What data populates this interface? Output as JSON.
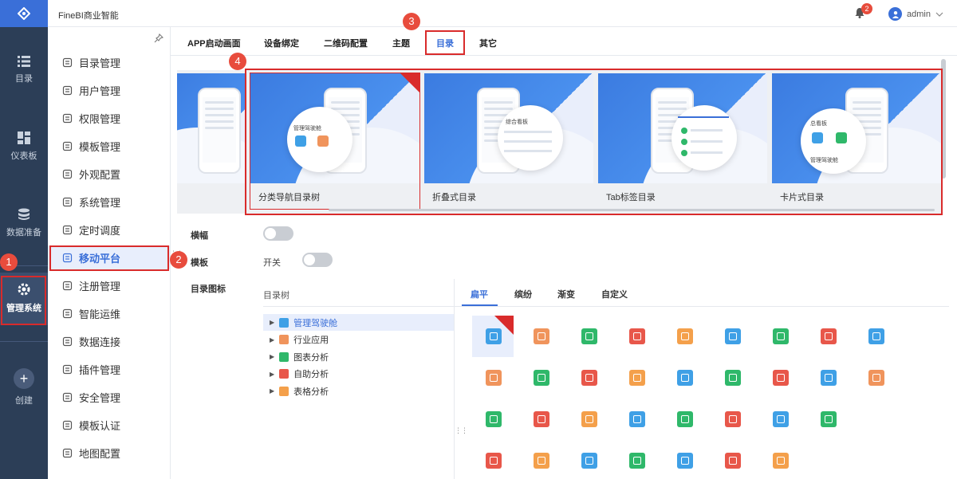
{
  "app": {
    "brand": "FineBI商业智能"
  },
  "leftnav": {
    "items": [
      {
        "label": "目录",
        "icon": "list-icon"
      },
      {
        "label": "仪表板",
        "icon": "dashboard-icon"
      },
      {
        "label": "数据准备",
        "icon": "database-icon"
      },
      {
        "label": "管理系统",
        "icon": "gear-icon"
      },
      {
        "label": "创建",
        "icon": "plus-icon"
      }
    ]
  },
  "header": {
    "notifications": "2",
    "user": "admin"
  },
  "menu": {
    "items": [
      {
        "label": "目录管理"
      },
      {
        "label": "用户管理"
      },
      {
        "label": "权限管理"
      },
      {
        "label": "模板管理"
      },
      {
        "label": "外观配置"
      },
      {
        "label": "系统管理"
      },
      {
        "label": "定时调度"
      },
      {
        "label": "移动平台"
      },
      {
        "label": "注册管理"
      },
      {
        "label": "智能运维"
      },
      {
        "label": "数据连接"
      },
      {
        "label": "插件管理"
      },
      {
        "label": "安全管理"
      },
      {
        "label": "模板认证"
      },
      {
        "label": "地图配置"
      }
    ]
  },
  "tabs": [
    "APP启动画面",
    "设备绑定",
    "二维码配置",
    "主题",
    "目录",
    "其它"
  ],
  "styles": [
    {
      "label": "分类导航目录树"
    },
    {
      "label": "折叠式目录"
    },
    {
      "label": "Tab标签目录"
    },
    {
      "label": "卡片式目录"
    }
  ],
  "phone_text": {
    "card1_a": "管理驾驶舱",
    "card2_a": "综合看板",
    "card4_a": "总看板",
    "card4_b": "管理驾驶舱"
  },
  "settings": {
    "landscape": "横幅",
    "template": "模板",
    "switch_label": "开关",
    "catalog_icon": "目录图标"
  },
  "tree": {
    "header": "目录树",
    "items": [
      {
        "label": "管理驾驶舱",
        "color": "#3fa0e6"
      },
      {
        "label": "行业应用",
        "color": "#f0945c"
      },
      {
        "label": "图表分析",
        "color": "#2fb86a"
      },
      {
        "label": "自助分析",
        "color": "#e8574a"
      },
      {
        "label": "表格分析",
        "color": "#f4a04b"
      }
    ]
  },
  "icon_tabs": [
    "扁平",
    "缤纷",
    "渐变",
    "自定义"
  ],
  "icon_colors": [
    [
      "#3fa0e6",
      "#f0945c",
      "#2fb86a",
      "#e8574a",
      "#f4a04b",
      "#3fa0e6",
      "#2fb86a",
      "#e8574a",
      "#3fa0e6"
    ],
    [
      "#f0945c",
      "#2fb86a",
      "#e8574a",
      "#f4a04b",
      "#3fa0e6",
      "#2fb86a",
      "#e8574a",
      "#3fa0e6",
      "#f0945c"
    ],
    [
      "#2fb86a",
      "#e8574a",
      "#f4a04b",
      "#3fa0e6",
      "#2fb86a",
      "#e8574a",
      "#3fa0e6",
      "#2fb86a"
    ],
    [
      "#e8574a",
      "#f4a04b",
      "#3fa0e6",
      "#2fb86a",
      "#3fa0e6",
      "#e8574a",
      "#f4a04b"
    ]
  ],
  "callouts": [
    "1",
    "2",
    "3",
    "4"
  ]
}
